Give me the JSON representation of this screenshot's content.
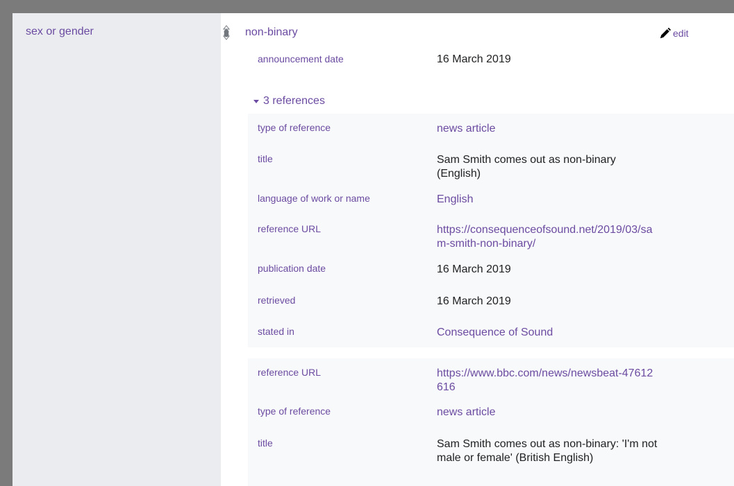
{
  "statement": {
    "property": "sex or gender",
    "value": "non-binary",
    "edit_label": "edit",
    "qualifier": {
      "key": "announcement date",
      "value": "16 March 2019"
    },
    "references_toggle": "3 references"
  },
  "references": [
    {
      "rows": [
        {
          "key": "type of reference",
          "value": "news article",
          "link": true
        },
        {
          "key": "title",
          "value": "Sam Smith comes out as non-binary (English)",
          "link": false
        },
        {
          "key": "language of work or name",
          "value": "English",
          "link": true
        },
        {
          "key": "reference URL",
          "value": "https://consequenceofsound.net/2019/03/sam-smith-non-binary/",
          "link": true
        },
        {
          "key": "publication date",
          "value": "16 March 2019",
          "link": false
        },
        {
          "key": "retrieved",
          "value": "16 March 2019",
          "link": false
        },
        {
          "key": "stated in",
          "value": "Consequence of Sound",
          "link": true
        }
      ]
    },
    {
      "rows": [
        {
          "key": "reference URL",
          "value": "https://www.bbc.com/news/newsbeat-47612616",
          "link": true
        },
        {
          "key": "type of reference",
          "value": "news article",
          "link": true
        },
        {
          "key": "title",
          "value": "Sam Smith comes out as non-binary: 'I'm not male or female' (British English)",
          "link": false
        }
      ]
    }
  ],
  "colors": {
    "link": "#6b4ba1",
    "text": "#202122",
    "property_column": "#eaecf0",
    "reference_background": "#f8f9fa"
  },
  "icons": {
    "rank": "rank-selector-icon",
    "edit": "pencil-icon",
    "toggle": "triangle-down-icon"
  }
}
